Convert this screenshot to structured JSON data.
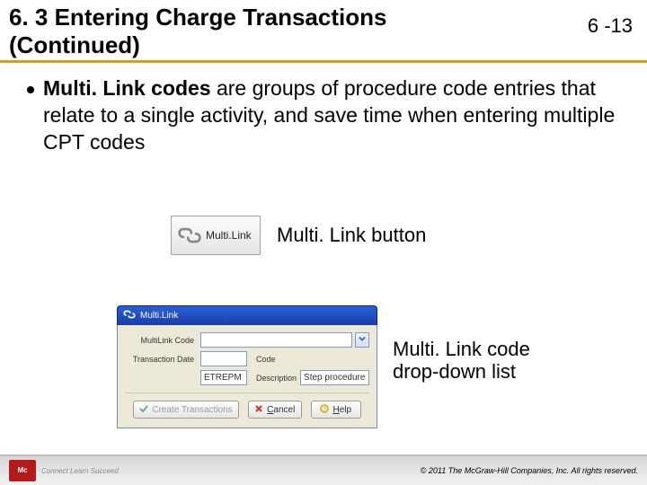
{
  "header": {
    "title": "6. 3 Entering Charge Transactions (Continued)",
    "page_number": "6 -13"
  },
  "bullet": {
    "bold": "Multi. Link codes",
    "rest": " are groups of procedure code entries that relate to a single activity, and save time when entering multiple CPT codes"
  },
  "button_demo": {
    "button_label": "Multi.Link",
    "caption": "Multi. Link button"
  },
  "dialog": {
    "title": "Multi.Link",
    "row1_label": "MultiLink Code",
    "row1_value": "",
    "row2_label": "Transaction Date",
    "row2_value": "",
    "row2_code_label": "Code",
    "row2_code_value": "ETREPM",
    "row2_desc_label": "Description",
    "row2_desc_value": "Step procedure",
    "btn_create": "Create Transactions",
    "btn_cancel": "Cancel",
    "btn_help": "Help",
    "caption": "Multi. Link code drop-down list"
  },
  "footer": {
    "logo_text": "Mc",
    "tagline": "Connect Learn Succeed",
    "copyright": "© 2011 The McGraw-Hill Companies, Inc. All rights reserved."
  }
}
